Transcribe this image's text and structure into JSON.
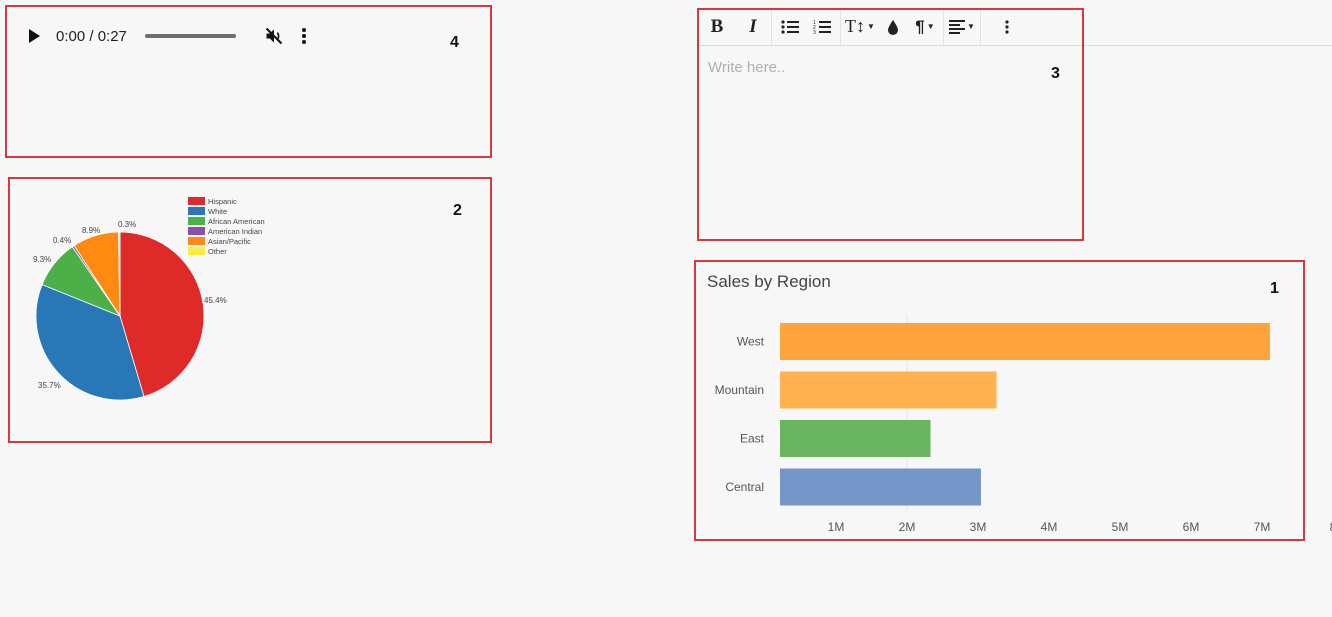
{
  "labels": {
    "audio": "4",
    "pie": "2",
    "editor": "3",
    "bar": "1"
  },
  "audio": {
    "time": "0:00 / 0:27",
    "play_icon": "play-icon",
    "mute_icon": "volume-muted-icon",
    "more_icon": "more-vert-icon"
  },
  "editor": {
    "placeholder": "Write here..",
    "toolbar": {
      "bold": "B",
      "italic": "I",
      "font_size": "T↕",
      "paragraph": "¶"
    }
  },
  "chart_data": [
    {
      "type": "bar",
      "orientation": "horizontal",
      "title": "Sales by Region",
      "categories": [
        "West",
        "Mountain",
        "East",
        "Central"
      ],
      "values": [
        6.9,
        3.05,
        2.12,
        2.83
      ],
      "colors": [
        "#ffa33d",
        "#ffb24f",
        "#6ab560",
        "#7495c7"
      ],
      "x_ticks": [
        "1M",
        "2M",
        "3M",
        "4M",
        "5M",
        "6M",
        "7M",
        "8"
      ],
      "xlim": [
        0,
        8
      ]
    },
    {
      "type": "pie",
      "legend_position": "top-right",
      "categories": [
        "Hispanic",
        "White",
        "African American",
        "American Indian",
        "Asian/Pacific",
        "Other"
      ],
      "values": [
        45.4,
        35.7,
        9.3,
        0.4,
        8.9,
        0.3
      ],
      "labels": [
        "45.4%",
        "35.7%",
        "9.3%",
        "0.4%",
        "8.9%",
        "0.3%"
      ],
      "colors": [
        "#df2a2a",
        "#2878b8",
        "#4caf48",
        "#8c4ea8",
        "#ff8a12",
        "#ffec3d"
      ]
    }
  ]
}
